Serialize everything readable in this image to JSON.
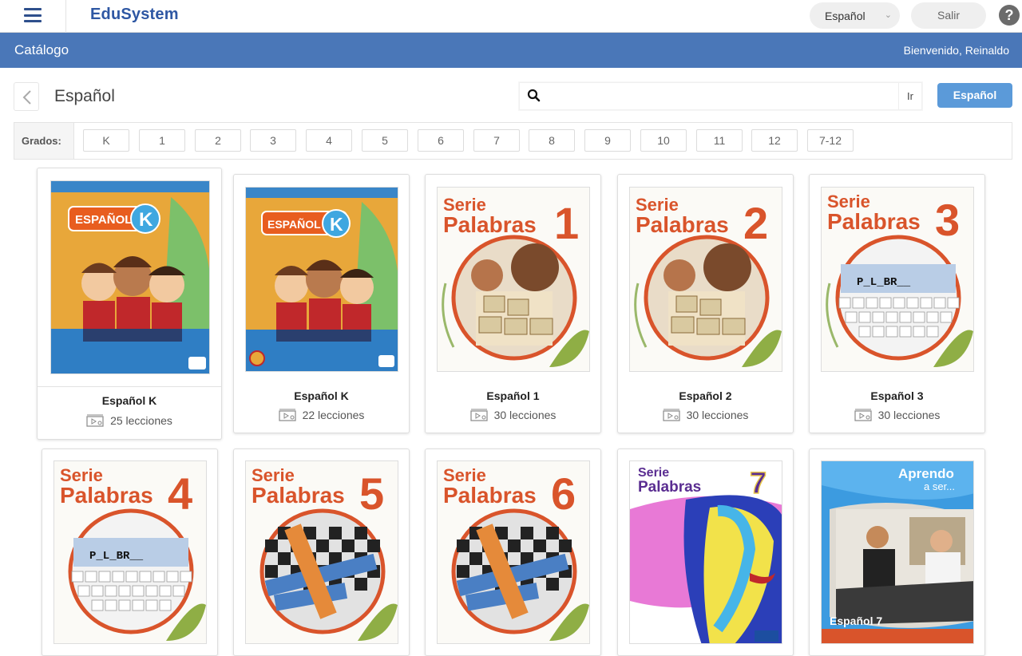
{
  "header": {
    "brand": "EduSystem",
    "language": "Español",
    "logout": "Salir",
    "help": "?"
  },
  "band": {
    "title": "Catálogo",
    "welcome": "Bienvenido, Reinaldo"
  },
  "page": {
    "title": "Español",
    "search_placeholder": "",
    "search_go": "Ir",
    "filter_button": "Español"
  },
  "grades": {
    "label": "Grados:",
    "items": [
      "K",
      "1",
      "2",
      "3",
      "4",
      "5",
      "6",
      "7",
      "8",
      "9",
      "10",
      "11",
      "12",
      "7-12"
    ]
  },
  "books": [
    {
      "title": "Español K",
      "lessons": "25 lecciones",
      "cover_text": "ESPAÑOL",
      "cover_mark": "K"
    },
    {
      "title": "Español K",
      "lessons": "22 lecciones",
      "cover_text": "ESPAÑOL",
      "cover_mark": "K"
    },
    {
      "title": "Español 1",
      "lessons": "30 lecciones",
      "cover_serie": "Serie",
      "cover_text": "Palabras",
      "cover_mark": "1"
    },
    {
      "title": "Español 2",
      "lessons": "30 lecciones",
      "cover_serie": "Serie",
      "cover_text": "Palabras",
      "cover_mark": "2"
    },
    {
      "title": "Español 3",
      "lessons": "30 lecciones",
      "cover_serie": "Serie",
      "cover_text": "Palabras",
      "cover_mark": "3",
      "cover_word": "P_L_BR__"
    },
    {
      "cover_serie": "Serie",
      "cover_text": "Palabras",
      "cover_mark": "4",
      "cover_word": "P_L_BR__"
    },
    {
      "cover_serie": "Serie",
      "cover_text": "Palabras",
      "cover_mark": "5"
    },
    {
      "cover_serie": "Serie",
      "cover_text": "Palabras",
      "cover_mark": "6"
    },
    {
      "cover_serie": "Serie",
      "cover_text": "Palabras",
      "cover_mark": "7"
    },
    {
      "cover_text": "Aprendo",
      "cover_sub": "a ser...",
      "cover_mark": "Español 7"
    }
  ],
  "colors": {
    "brand": "#2e57a3",
    "band": "#4a77b8",
    "filter_button": "#5b9ad9",
    "serie_orange": "#d9542b",
    "serie7_purple": "#5a2d91"
  }
}
